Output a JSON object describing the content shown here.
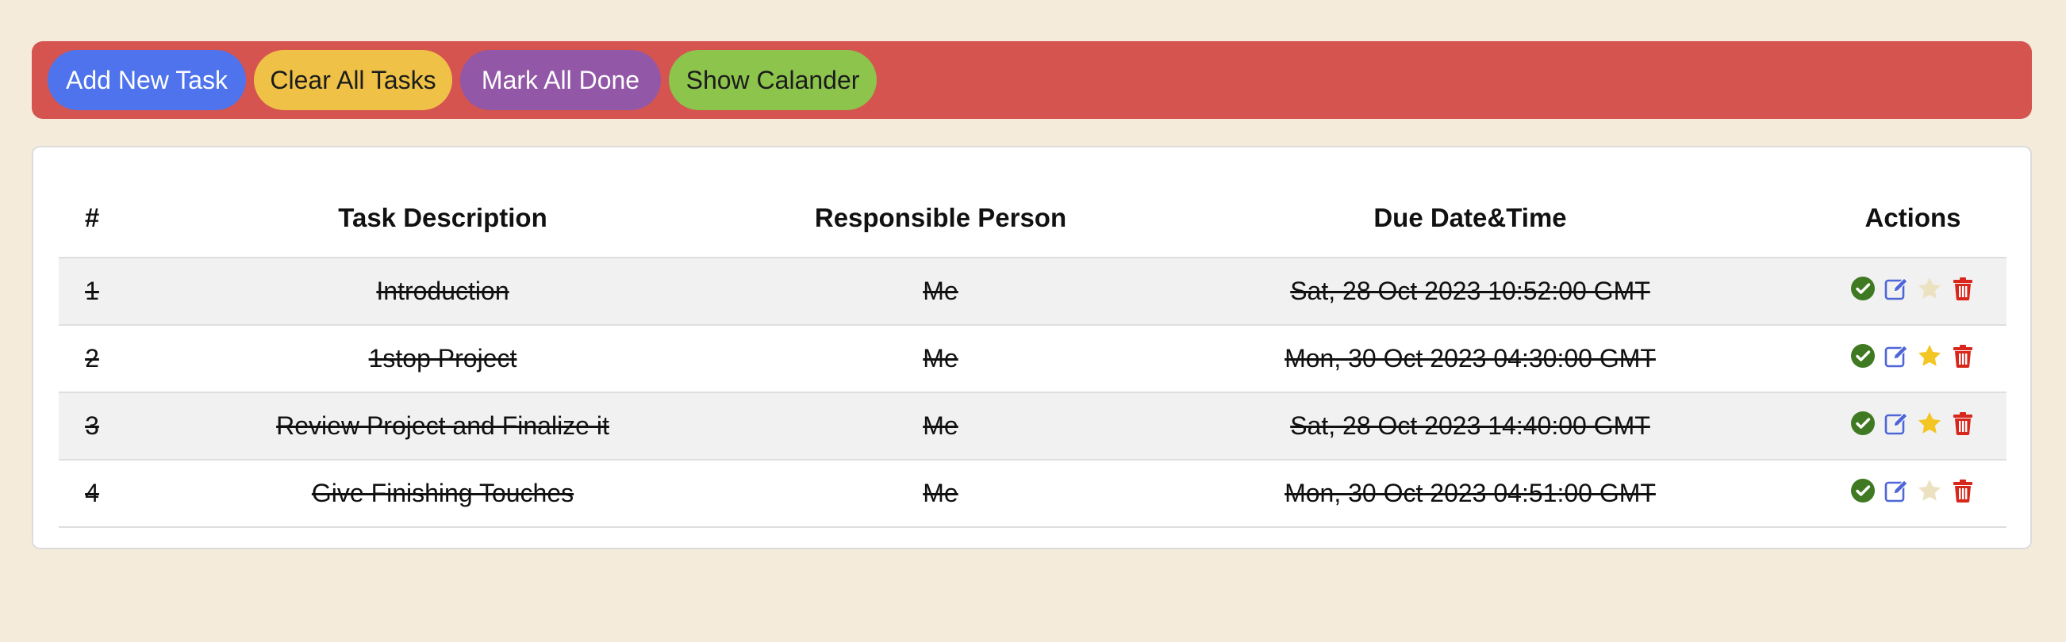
{
  "toolbar": {
    "add_label": "Add New Task",
    "clear_label": "Clear All Tasks",
    "mark_done_label": "Mark All Done",
    "calendar_label": "Show Calander"
  },
  "colors": {
    "background": "#f5ebda",
    "toolbar": "#d5544f",
    "add_button": "#4e73ec",
    "clear_button": "#efc146",
    "mark_done_button": "#9257a6",
    "calendar_button": "#8cc44c",
    "done_icon": "#3f7a22",
    "edit_icon": "#4e66d8",
    "star_active": "#f3c623",
    "star_inactive": "#ece2c2",
    "delete_icon": "#d8261c"
  },
  "table": {
    "headers": {
      "num": "#",
      "description": "Task Description",
      "person": "Responsible Person",
      "due": "Due Date&Time",
      "actions": "Actions"
    },
    "rows": [
      {
        "num": "1",
        "description": "Introduction",
        "person": "Me",
        "due": "Sat, 28 Oct 2023 10:52:00 GMT",
        "done": true,
        "starred": false,
        "icons": [
          "check-circle-icon",
          "edit-icon",
          "star-icon",
          "trash-icon"
        ]
      },
      {
        "num": "2",
        "description": "1stop Project",
        "person": "Me",
        "due": "Mon, 30 Oct 2023 04:30:00 GMT",
        "done": true,
        "starred": true,
        "icons": [
          "check-circle-icon",
          "edit-icon",
          "star-icon",
          "trash-icon"
        ]
      },
      {
        "num": "3",
        "description": "Review Project and Finalize it",
        "person": "Me",
        "due": "Sat, 28 Oct 2023 14:40:00 GMT",
        "done": true,
        "starred": true,
        "icons": [
          "check-circle-icon",
          "edit-icon",
          "star-icon",
          "trash-icon"
        ]
      },
      {
        "num": "4",
        "description": "Give Finishing Touches",
        "person": "Me",
        "due": "Mon, 30 Oct 2023 04:51:00 GMT",
        "done": true,
        "starred": false,
        "icons": [
          "check-circle-icon",
          "edit-icon",
          "star-icon",
          "trash-icon"
        ]
      }
    ]
  }
}
